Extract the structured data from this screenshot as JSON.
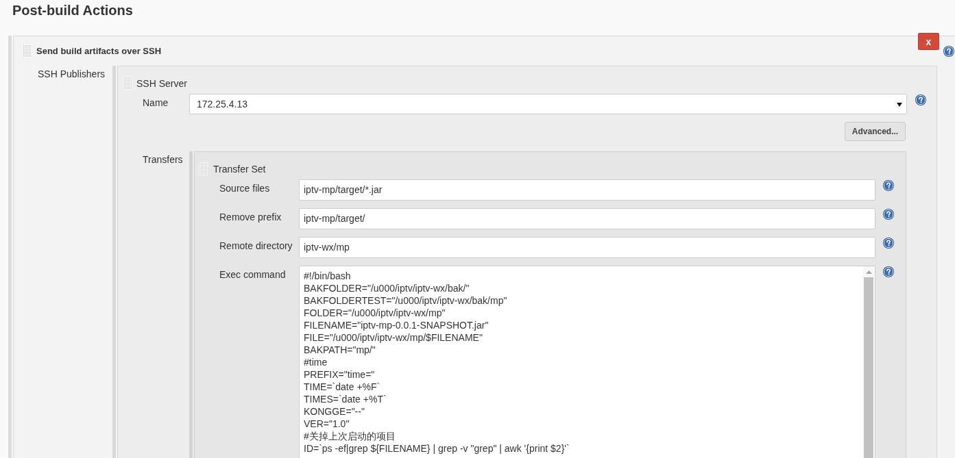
{
  "page": {
    "title": "Post-build Actions"
  },
  "action": {
    "title": "Send build artifacts over SSH",
    "delete_button": "x",
    "publishers_label": "SSH Publishers",
    "ssh_server": {
      "title": "SSH Server",
      "name": {
        "label": "Name",
        "value": "172.25.4.13"
      },
      "advanced_button": "Advanced...",
      "transfers_label": "Transfers",
      "transfer_set": {
        "title": "Transfer Set",
        "fields": [
          {
            "kind": "text",
            "label": "Source files",
            "value": "iptv-mp/target/*.jar"
          },
          {
            "kind": "text",
            "label": "Remove prefix",
            "value": "iptv-mp/target/"
          },
          {
            "kind": "text",
            "label": "Remote directory",
            "value": "iptv-wx/mp"
          },
          {
            "kind": "multiline",
            "label": "Exec command",
            "lines": [
              "#!/bin/bash",
              "BAKFOLDER=\"/u000/iptv/iptv-wx/bak/\"",
              "BAKFOLDERTEST=\"/u000/iptv/iptv-wx/bak/mp\"",
              "FOLDER=\"/u000/iptv/iptv-wx/mp\"",
              "FILENAME=\"iptv-mp-0.0.1-SNAPSHOT.jar\"",
              "FILE=\"/u000/iptv/iptv-wx/mp/$FILENAME\"",
              "BAKPATH=\"mp/\"",
              "#time",
              "PREFIX=\"time=\"",
              "TIME=`date +%F`",
              "TIMES=`date +%T`",
              "KONGGE=\"--\"",
              "VER=\"1.0\"",
              "#关掉上次启动的项目",
              "ID=`ps -ef|grep ${FILENAME} | grep -v \"grep\" | awk '{print $2}'`"
            ]
          }
        ]
      }
    }
  }
}
